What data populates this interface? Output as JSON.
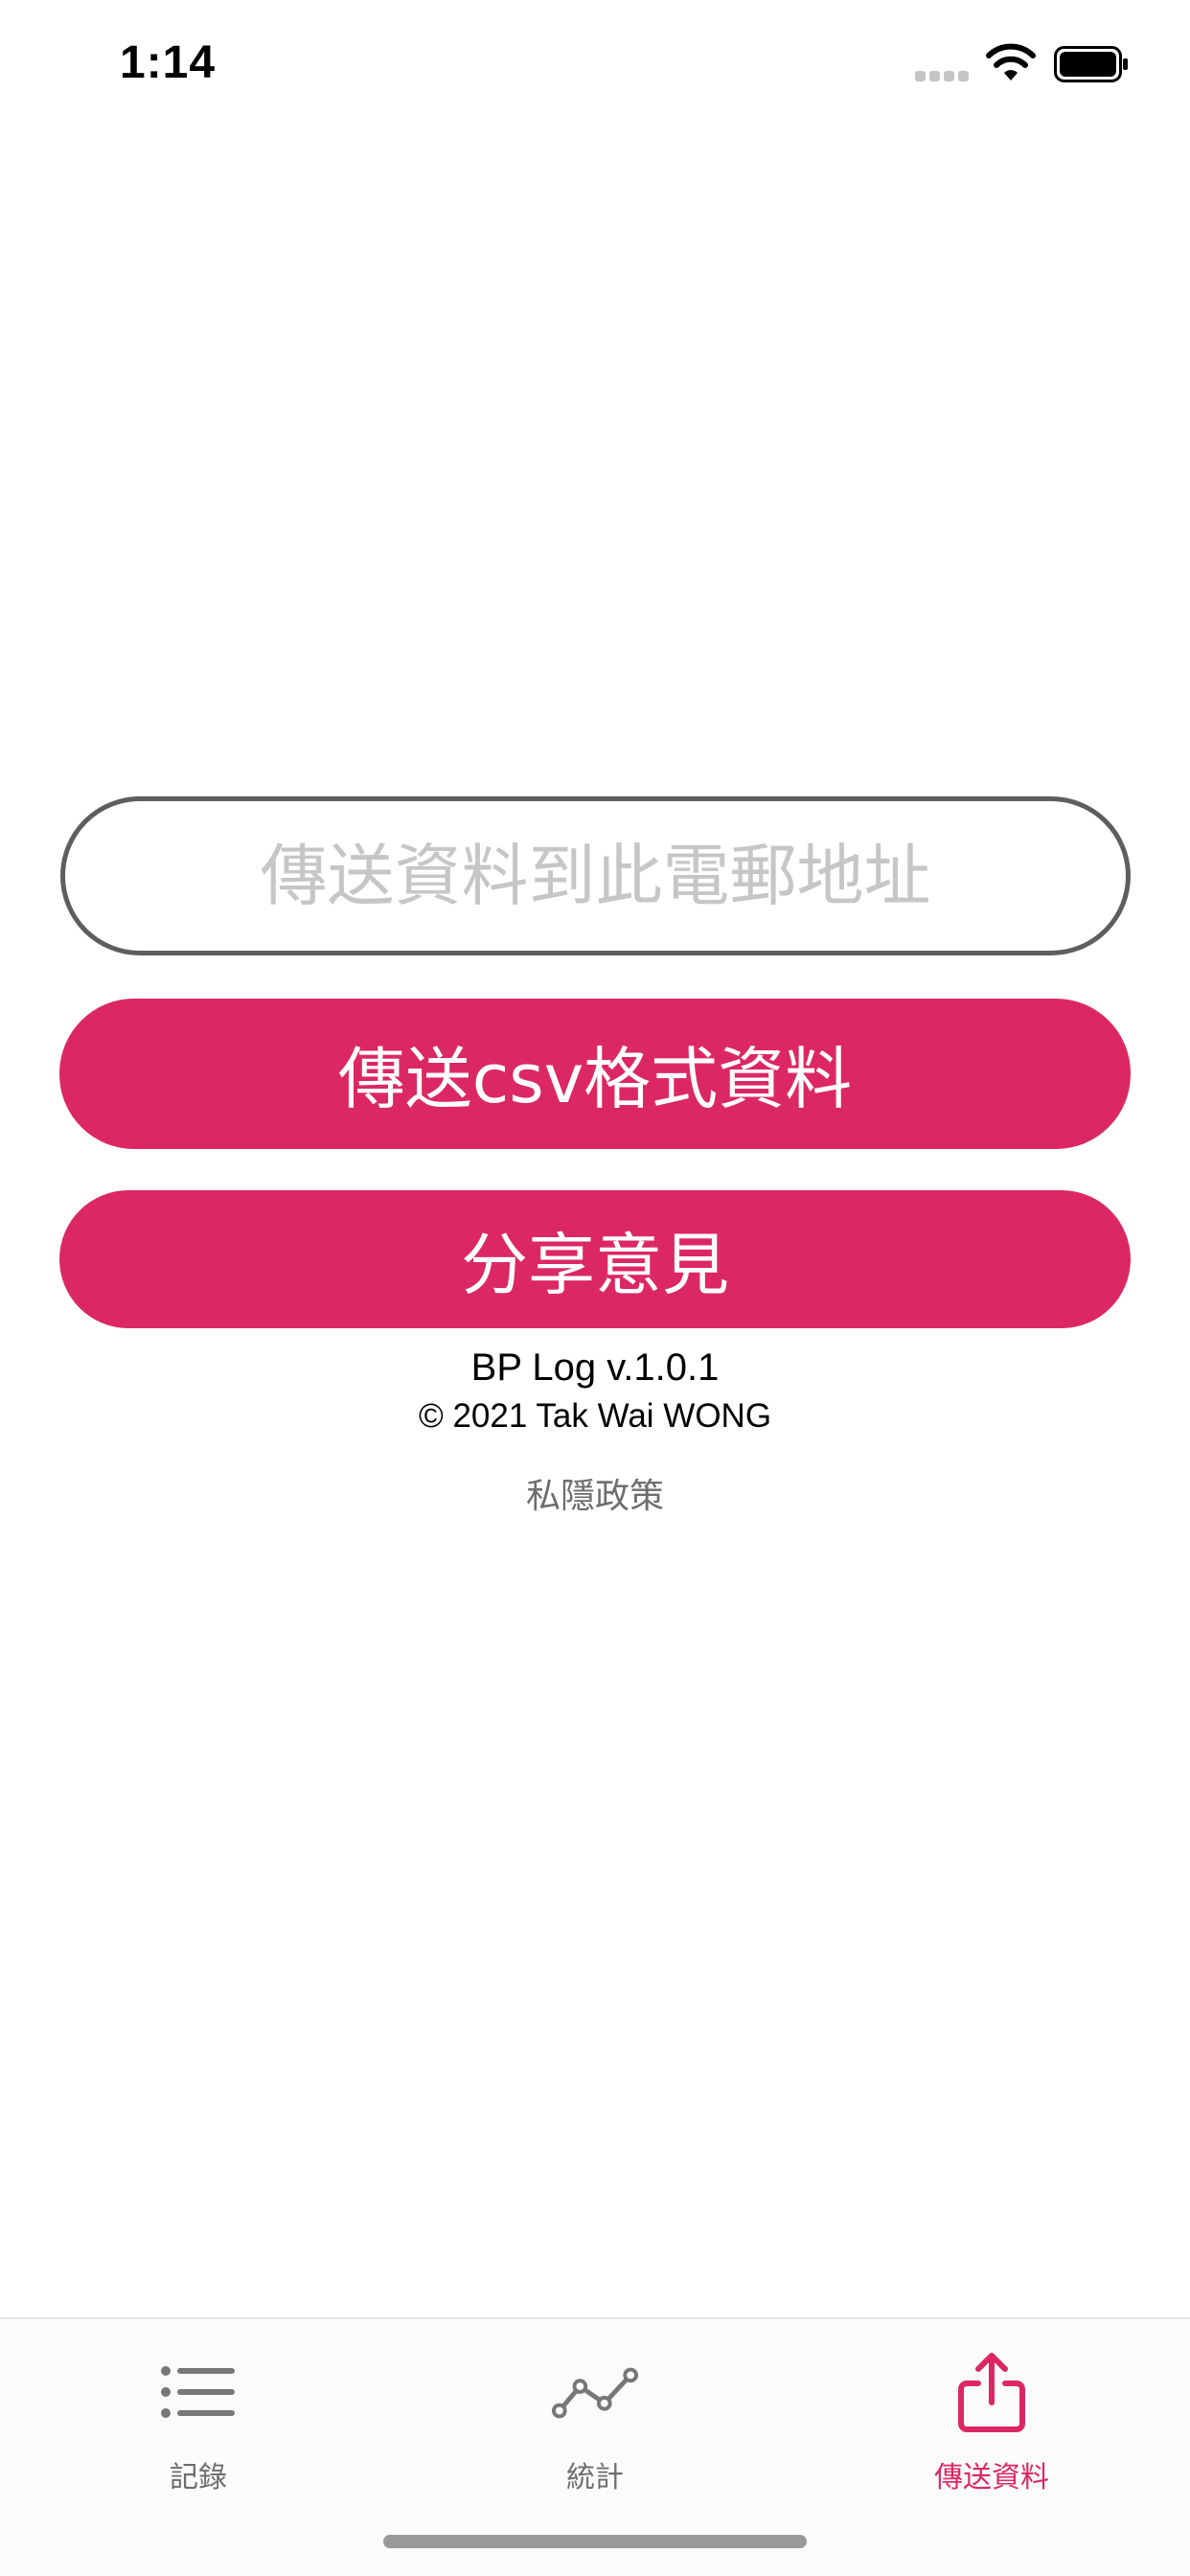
{
  "status_bar": {
    "time": "1:14",
    "signal_icon": "cellular-signal-icon",
    "wifi_icon": "wifi-icon",
    "battery_icon": "battery-icon"
  },
  "main": {
    "email_field": {
      "value": "",
      "placeholder": "傳送資料到此電郵地址"
    },
    "send_csv_button": "傳送csv格式資料",
    "feedback_button": "分享意見",
    "app_version": "BP Log v.1.0.1",
    "copyright": "© 2021 Tak Wai WONG",
    "privacy_link": "私隱政策"
  },
  "tab_bar": {
    "items": [
      {
        "label": "記錄",
        "icon": "list-icon",
        "selected": false
      },
      {
        "label": "統計",
        "icon": "line-chart-icon",
        "selected": false
      },
      {
        "label": "傳送資料",
        "icon": "share-icon",
        "selected": true
      }
    ]
  },
  "colors": {
    "accent": "#dc2862",
    "field_border": "#5e5e5e",
    "placeholder": "#c6c6c6",
    "tab_inactive": "#6d6d6d"
  }
}
